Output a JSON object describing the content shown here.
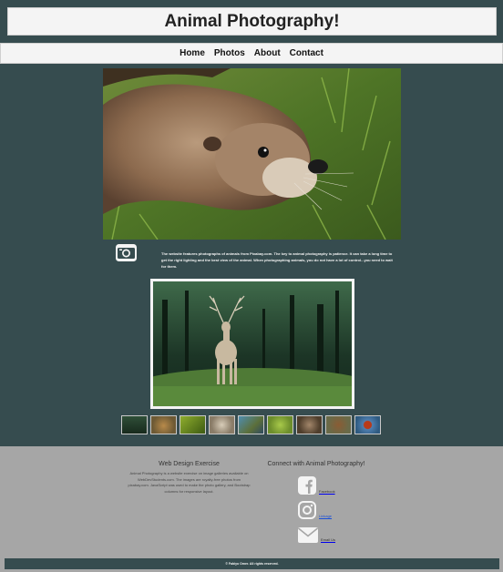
{
  "header": {
    "title": "Animal Photography!"
  },
  "nav": {
    "items": [
      "Home",
      "Photos",
      "About",
      "Contact"
    ]
  },
  "intro": {
    "text": "The website features photographs of animals from Pixabay.com. The key to animal photography is patience. It can take a long time to get the right lighting and the best view of the animal. When photographing animals, you do not have a lot of control...you need to wait for them."
  },
  "gallery": {
    "thumbnails": [
      "forest-deer",
      "lion",
      "green-lizard",
      "hedgehog",
      "sea-turtle",
      "green-frog",
      "otter-face",
      "beaver",
      "ladybug"
    ]
  },
  "footer": {
    "left_title": "Web Design Exercise",
    "left_text": "Animal Photography is a website exercise on image galleries available on WebDevStudents.com. The images are royalty-free photos from pixabay.com. JavaScript was used to make the photo gallery, and Bootstrap columns for responsive layout.",
    "right_title": "Connect with Animal Photography!",
    "social": [
      {
        "icon": "facebook-icon",
        "label": "Facebook"
      },
      {
        "icon": "instagram-icon",
        "label": "Linkage"
      },
      {
        "icon": "envelope-icon",
        "label": "Email Us"
      }
    ],
    "copyright": "© Fabiyo Omer. All rights reserved."
  }
}
